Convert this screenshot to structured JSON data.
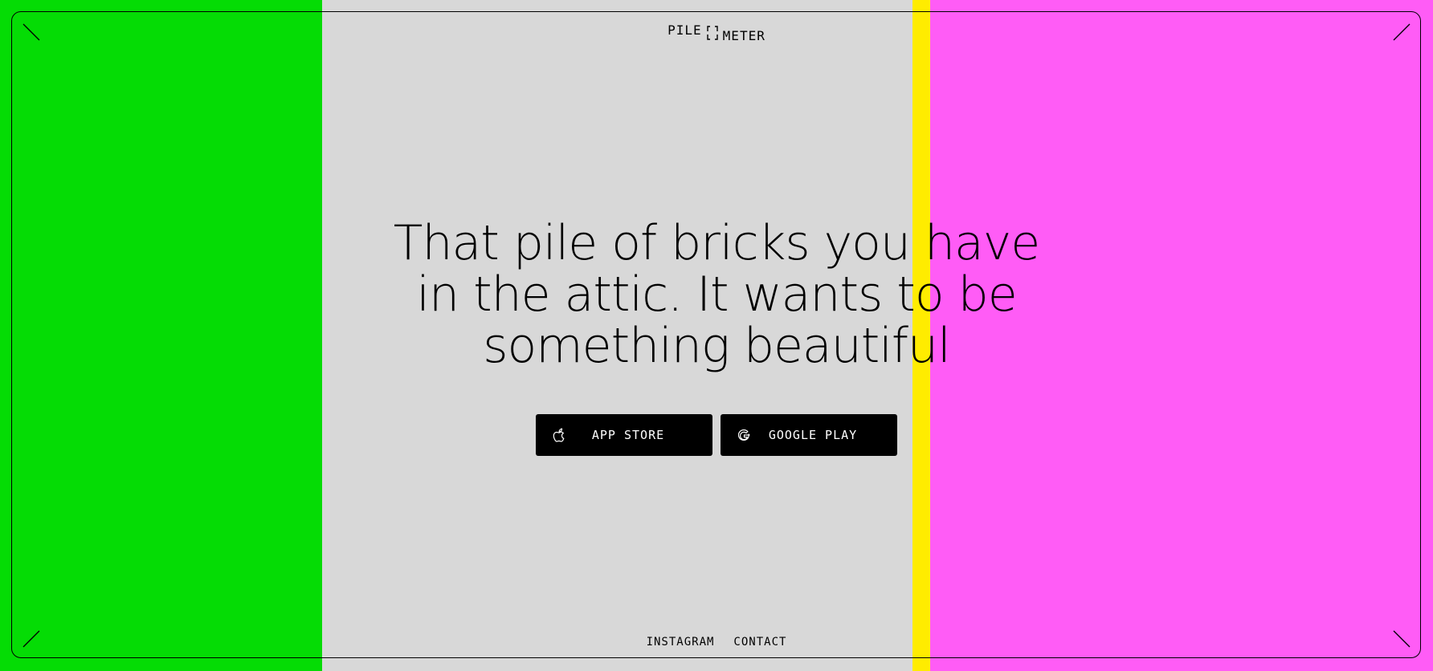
{
  "colors": {
    "background": "#d8d8d8",
    "band_green": "#05dc05",
    "band_gray": "#d8d8d8",
    "band_yellow": "#ffec00",
    "band_pink": "#ff5cf6",
    "button_bg": "#000000",
    "button_text": "#ffffff",
    "text": "#000000"
  },
  "header": {
    "logo_word_1": "PILE",
    "logo_word_2": "METER",
    "logo_mark_icon": "bracket-square-icon"
  },
  "hero": {
    "line_1": "That pile of bricks you have",
    "line_2": "in the attic. It wants to be",
    "line_3": "something beautiful"
  },
  "stores": {
    "app_store": {
      "label": "APP STORE",
      "icon": "apple-icon"
    },
    "google_play": {
      "label": "GOOGLE PLAY",
      "icon": "google-icon"
    }
  },
  "footer": {
    "links": [
      "INSTAGRAM",
      "CONTACT"
    ]
  },
  "corners": {
    "top_left_icon": "corner-tl-icon",
    "top_right_icon": "corner-tr-icon",
    "bottom_left_icon": "corner-bl-icon",
    "bottom_right_icon": "corner-br-icon"
  }
}
